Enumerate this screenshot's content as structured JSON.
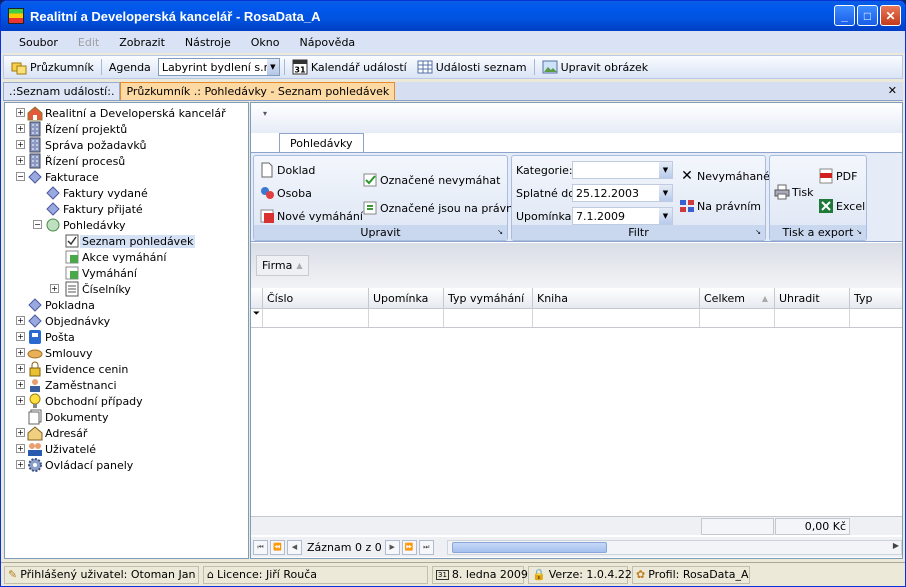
{
  "window": {
    "title": "Realitní a Developerská kancelář - RosaData_A"
  },
  "menu": [
    "Soubor",
    "Edit",
    "Zobrazit",
    "Nástroje",
    "Okno",
    "Nápověda"
  ],
  "toolbar": {
    "explorer": "Průzkumník",
    "agenda_label": "Agenda",
    "agenda_value": "Labyrint bydlení s.r.o",
    "calendar": "Kalendář událostí",
    "calendar_icon_text": "31",
    "events_list": "Události seznam",
    "edit_image": "Upravit obrázek"
  },
  "tabs": [
    ".:Seznam událostí:.",
    "Průzkumník .: Pohledávky - Seznam pohledávek"
  ],
  "tree": [
    {
      "label": "Realitní a Developerská kancelář",
      "depth": 0,
      "pm": "+",
      "icon": "house-icon"
    },
    {
      "label": "Řízení projektů",
      "depth": 0,
      "pm": "+",
      "icon": "building-icon"
    },
    {
      "label": "Správa požadavků",
      "depth": 0,
      "pm": "+",
      "icon": "building-icon"
    },
    {
      "label": "Řízení procesů",
      "depth": 0,
      "pm": "+",
      "icon": "building-icon"
    },
    {
      "label": "Fakturace",
      "depth": 0,
      "pm": "−",
      "icon": "diamond-icon"
    },
    {
      "label": "Faktury vydané",
      "depth": 1,
      "pm": "",
      "icon": "diamond-icon"
    },
    {
      "label": "Faktury přijaté",
      "depth": 1,
      "pm": "",
      "icon": "diamond-icon"
    },
    {
      "label": "Pohledávky",
      "depth": 1,
      "pm": "−",
      "icon": "globe-icon"
    },
    {
      "label": "Seznam pohledávek",
      "depth": 2,
      "pm": "",
      "icon": "checklist-icon",
      "selected": true
    },
    {
      "label": "Akce vymáhání",
      "depth": 2,
      "pm": "",
      "icon": "doc-icon"
    },
    {
      "label": "Vymáhání",
      "depth": 2,
      "pm": "",
      "icon": "doc-icon"
    },
    {
      "label": "Číselníky",
      "depth": 2,
      "pm": "+",
      "icon": "list-icon"
    },
    {
      "label": "Pokladna",
      "depth": 0,
      "pm": "",
      "icon": "diamond-icon"
    },
    {
      "label": "Objednávky",
      "depth": 0,
      "pm": "+",
      "icon": "diamond-icon"
    },
    {
      "label": "Pošta",
      "depth": 0,
      "pm": "+",
      "icon": "mail-icon"
    },
    {
      "label": "Smlouvy",
      "depth": 0,
      "pm": "+",
      "icon": "handshake-icon"
    },
    {
      "label": "Evidence cenin",
      "depth": 0,
      "pm": "+",
      "icon": "lock-icon"
    },
    {
      "label": "Zaměstnanci",
      "depth": 0,
      "pm": "+",
      "icon": "person-icon"
    },
    {
      "label": "Obchodní případy",
      "depth": 0,
      "pm": "+",
      "icon": "bulb-icon"
    },
    {
      "label": "Dokumenty",
      "depth": 0,
      "pm": "",
      "icon": "docs-icon"
    },
    {
      "label": "Adresář",
      "depth": 0,
      "pm": "+",
      "icon": "home-icon"
    },
    {
      "label": "Uživatelé",
      "depth": 0,
      "pm": "+",
      "icon": "users-icon"
    },
    {
      "label": "Ovládací panely",
      "depth": 0,
      "pm": "+",
      "icon": "gear-icon"
    }
  ],
  "ribbon": {
    "tab": "Pohledávky",
    "edit": {
      "caption": "Upravit",
      "doklad": "Doklad",
      "osoba": "Osoba",
      "nove": "Nové vymáhání",
      "oznac_nevym": "Označené nevymáhat",
      "oznac_prav": "Označené jsou na právním"
    },
    "filter": {
      "caption": "Filtr",
      "kategorie": "Kategorie:",
      "kategorie_value": "",
      "splatne": "Splatné do:",
      "splatne_value": "25.12.2003",
      "upominka": "Upomínka  :",
      "upominka_value": "7.1.2009",
      "nevym": "Nevymáhané",
      "na_pravnim": "Na právním"
    },
    "print": {
      "caption": "Tisk a export",
      "tisk": "Tisk",
      "pdf": "PDF",
      "excel": "Excel"
    }
  },
  "grid": {
    "group_chip": "Firma",
    "columns": [
      "Číslo",
      "Upomínka",
      "Typ vymáhání",
      "Kniha",
      "Celkem",
      "Uhradit",
      "Typ"
    ],
    "sum_value": "0,00 Kč",
    "nav_text": "Záznam 0 z 0"
  },
  "status": {
    "user": "Přihlášený uživatel: Otoman Jan",
    "licence": "Licence: Jiří Rouča",
    "date": "8. ledna 2009",
    "date_icon_text": "31",
    "version": "Verze: 1.0.4.22",
    "profile": "Profil: RosaData_A"
  }
}
